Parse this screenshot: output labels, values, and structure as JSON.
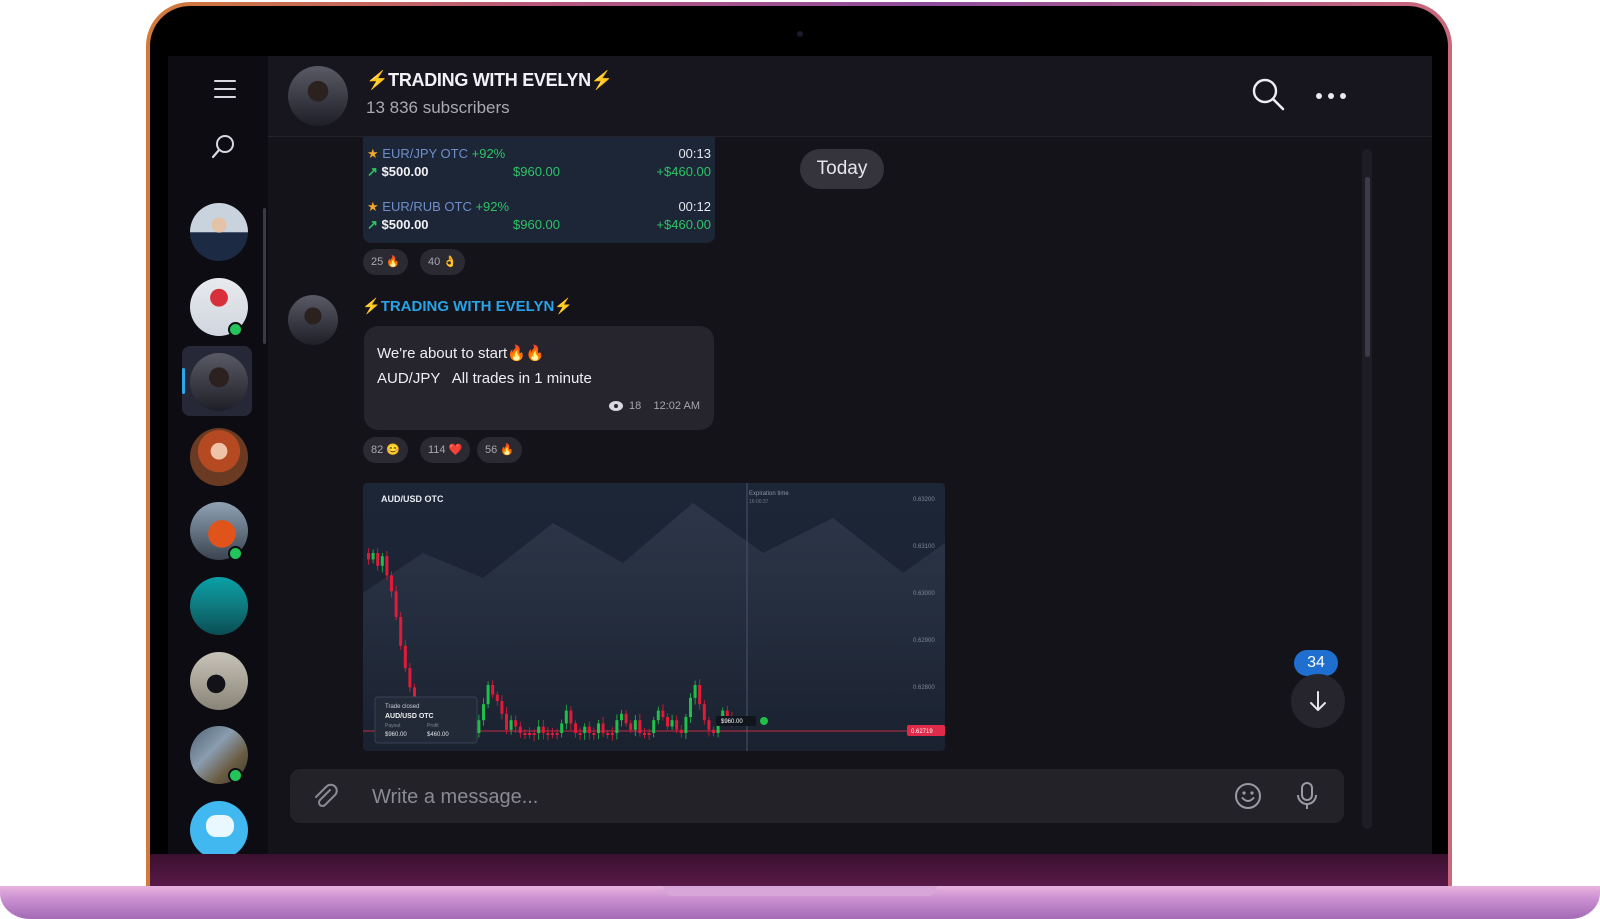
{
  "header": {
    "title": "TRADING WITH EVELYN",
    "bolt": "⚡",
    "subscribers": "13 836 subscribers"
  },
  "composer": {
    "placeholder": "Write a message..."
  },
  "feed": {
    "date_label": "Today",
    "trades": [
      {
        "pair": "EUR/JPY OTC",
        "pct": "+92%",
        "time": "00:13",
        "stake": "$500.00",
        "payout": "$960.00",
        "profit": "+$460.00"
      },
      {
        "pair": "EUR/RUB OTC",
        "pct": "+92%",
        "time": "00:12",
        "stake": "$500.00",
        "payout": "$960.00",
        "profit": "+$460.00"
      }
    ],
    "reactions_1": [
      {
        "count": "25",
        "emoji": "🔥"
      },
      {
        "count": "40",
        "emoji": "👌"
      }
    ],
    "message": {
      "author": "TRADING WITH EVELYN",
      "line1": "We're about to start🔥🔥",
      "line2": "AUD/JPY   All trades in 1 minute",
      "views": "18",
      "time": "12:02 AM"
    },
    "reactions_2": [
      {
        "count": "82",
        "emoji": "😊"
      },
      {
        "count": "114",
        "emoji": "❤️"
      },
      {
        "count": "56",
        "emoji": "🔥"
      }
    ],
    "unread_count": "34"
  },
  "chart_image": {
    "pair": "AUD/USD OTC",
    "expiration_label": "Expiration time",
    "expiration_value": "16:00:37",
    "price_ticks": [
      "0.63200",
      "0.63100",
      "0.63000",
      "0.62900",
      "0.62800"
    ],
    "current_price": "0.62719",
    "trade_box": {
      "title": "Trade closed",
      "pair": "AUD/USD OTC",
      "payout_label": "Payout",
      "profit_label": "Profit",
      "payout": "$960.00",
      "profit": "$460.00"
    },
    "marker_label": "$960.00",
    "colors": {
      "up": "#1fbf4a",
      "down": "#e21a3a"
    }
  },
  "icons": {
    "rail": [
      "menu-icon",
      "search-icon"
    ],
    "header": [
      "search-icon",
      "more-icon"
    ],
    "composer": [
      "paperclip-icon",
      "emoji-icon",
      "mic-icon"
    ],
    "scroll": "arrow-down-icon"
  },
  "colors": {
    "accent": "#2aa2e6",
    "positive": "#2ec266",
    "badge": "#1e6fd0"
  }
}
